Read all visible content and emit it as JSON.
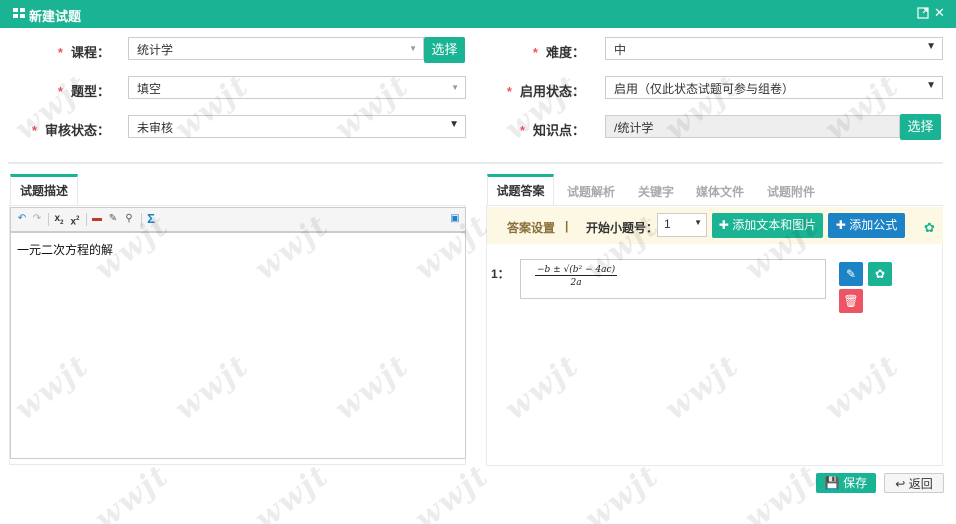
{
  "window": {
    "title": "新建试题",
    "restore_icon": "maximize-icon",
    "close_symbol": "✕"
  },
  "form": {
    "course": {
      "label": "课程：",
      "value": "统计学",
      "button": "选择"
    },
    "difficulty": {
      "label": "难度：",
      "value": "中"
    },
    "question_type": {
      "label": "题型：",
      "value": "填空"
    },
    "enable_status": {
      "label": "启用状态：",
      "value": "启用（仅此状态试题可参与组卷）"
    },
    "review_status": {
      "label": "审核状态：",
      "value": "未审核"
    },
    "knowledge_point": {
      "label": "知识点：",
      "value": "/统计学",
      "button": "选择"
    },
    "required_mark": "*"
  },
  "left_panel": {
    "tab": "试题描述",
    "content": "一元二次方程的解"
  },
  "right_panel": {
    "tabs": [
      "试题答案",
      "试题解析",
      "关键字",
      "媒体文件",
      "试题附件"
    ],
    "answer_settings_label": "答案设置",
    "separator": "|",
    "start_number_label": "开始小题号：",
    "start_number_value": "1",
    "add_text_button": "添加文本和图片",
    "add_formula_button": "添加公式",
    "answer_index": "1：",
    "formula": {
      "numerator": "−b ± √(b² − 4ac)",
      "denominator": "2a"
    }
  },
  "footer": {
    "save_button": "保存",
    "back_button": "返回"
  },
  "colors": {
    "primary": "#1ab394",
    "blue": "#1c84c6",
    "danger": "#ed5565",
    "warning_bg": "#fcf8e3"
  }
}
